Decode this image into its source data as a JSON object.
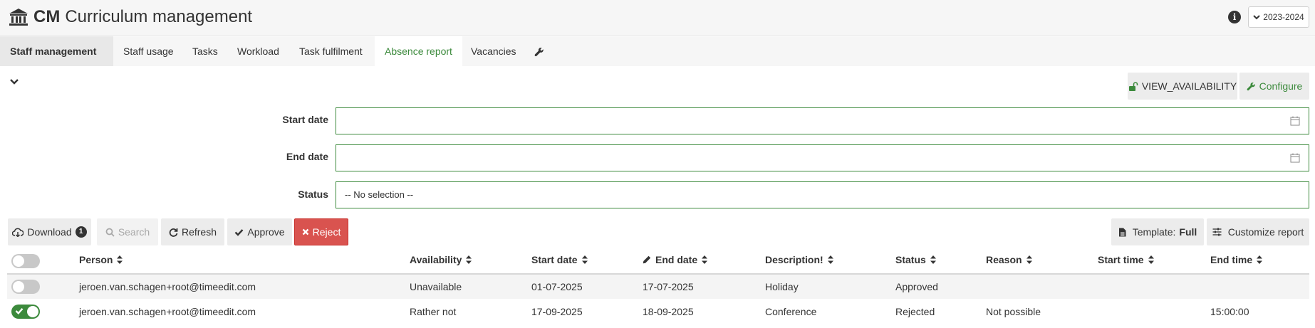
{
  "header": {
    "app_abbr": "CM",
    "app_title": "Curriculum management",
    "year": "2023-2024"
  },
  "tabs": [
    {
      "label": "Staff management"
    },
    {
      "label": "Staff usage"
    },
    {
      "label": "Tasks"
    },
    {
      "label": "Workload"
    },
    {
      "label": "Task fulfilment"
    },
    {
      "label": "Absence report"
    },
    {
      "label": "Vacancies"
    }
  ],
  "top_actions": {
    "view_availability": "VIEW_AVAILABILITY",
    "configure": "Configure"
  },
  "form": {
    "start_date_label": "Start date",
    "start_date_value": "",
    "end_date_label": "End date",
    "end_date_value": "",
    "status_label": "Status",
    "status_value": "-- No selection --"
  },
  "toolbar": {
    "download": "Download",
    "download_count": "1",
    "search": "Search",
    "refresh": "Refresh",
    "approve": "Approve",
    "reject": "Reject",
    "template_prefix": "Template:",
    "template_value": "Full",
    "customize": "Customize report"
  },
  "table": {
    "columns": [
      "Person",
      "Availability",
      "Start date",
      "End date",
      "Description!",
      "Status",
      "Reason",
      "Start time",
      "End time"
    ],
    "rows": [
      {
        "selected": false,
        "person": "jeroen.van.schagen+root@timeedit.com",
        "availability": "Unavailable",
        "start_date": "01-07-2025",
        "end_date": "17-07-2025",
        "description": "Holiday",
        "status": "Approved",
        "reason": "",
        "start_time": "",
        "end_time": ""
      },
      {
        "selected": true,
        "person": "jeroen.van.schagen+root@timeedit.com",
        "availability": "Rather not",
        "start_date": "17-09-2025",
        "end_date": "18-09-2025",
        "description": "Conference",
        "status": "Rejected",
        "reason": "Not possible",
        "start_time": "",
        "end_time": "15:00:00"
      }
    ]
  },
  "colors": {
    "accent": "#3c8a3c",
    "danger": "#d9534f",
    "header_bg": "#f6f6f6"
  }
}
